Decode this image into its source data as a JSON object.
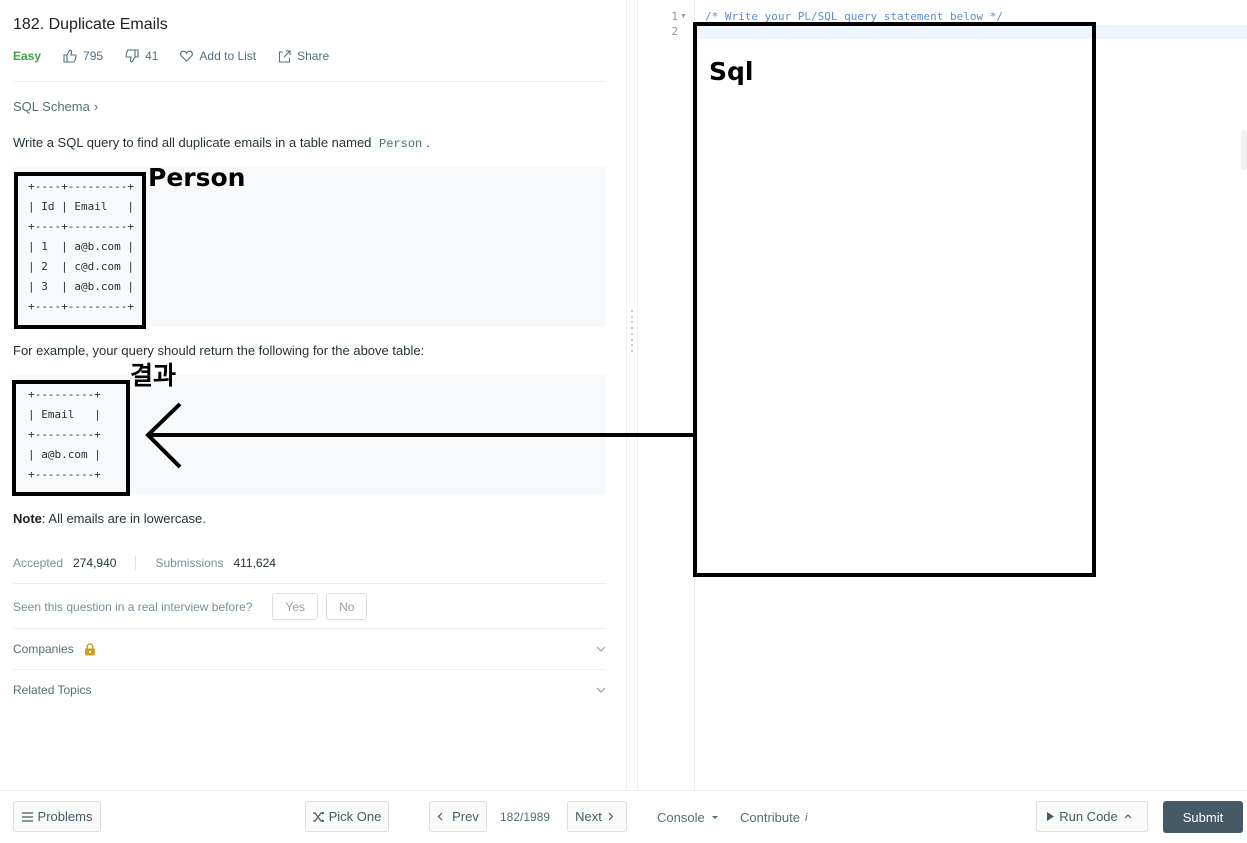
{
  "problem": {
    "title": "182. Duplicate Emails",
    "difficulty": "Easy",
    "likes": "795",
    "dislikes": "41",
    "add_to_list": "Add to List",
    "share": "Share",
    "schema_link": "SQL Schema",
    "desc_prefix": "Write a SQL query to find all duplicate emails in a table named",
    "table_name": "Person",
    "desc_suffix": ".",
    "person_table": "+----+---------+\n| Id | Email   |\n+----+---------+\n| 1  | a@b.com |\n| 2  | c@d.com |\n| 3  | a@b.com |\n+----+---------+",
    "example_text": "For example, your query should return the following for the above table:",
    "result_table": "+---------+\n| Email   |\n+---------+\n| a@b.com |\n+---------+",
    "note_label": "Note",
    "note_text": ": All emails are in lowercase.",
    "accepted_label": "Accepted",
    "accepted_value": "274,940",
    "submissions_label": "Submissions",
    "submissions_value": "411,624",
    "interview_question": "Seen this question in a real interview before?",
    "yes_label": "Yes",
    "no_label": "No",
    "companies_label": "Companies",
    "related_topics_label": "Related Topics"
  },
  "annotations": {
    "person_label": "Person",
    "result_label": "결과",
    "sql_label": "Sql"
  },
  "editor": {
    "line_numbers": [
      "1",
      "2"
    ],
    "line1": "/* Write your PL/SQL query statement below */",
    "line2": ""
  },
  "bottom_bar": {
    "problems": "Problems",
    "pick_one": "Pick One",
    "prev": "Prev",
    "page": "182/1989",
    "next": "Next",
    "console": "Console",
    "contribute": "Contribute",
    "contribute_suffix": "i",
    "run_code": "Run Code",
    "submit": "Submit"
  },
  "colors": {
    "easy": "#43a047",
    "submit_bg": "#455a64",
    "comment": "#5c8fd6",
    "lock": "#c9a227"
  }
}
